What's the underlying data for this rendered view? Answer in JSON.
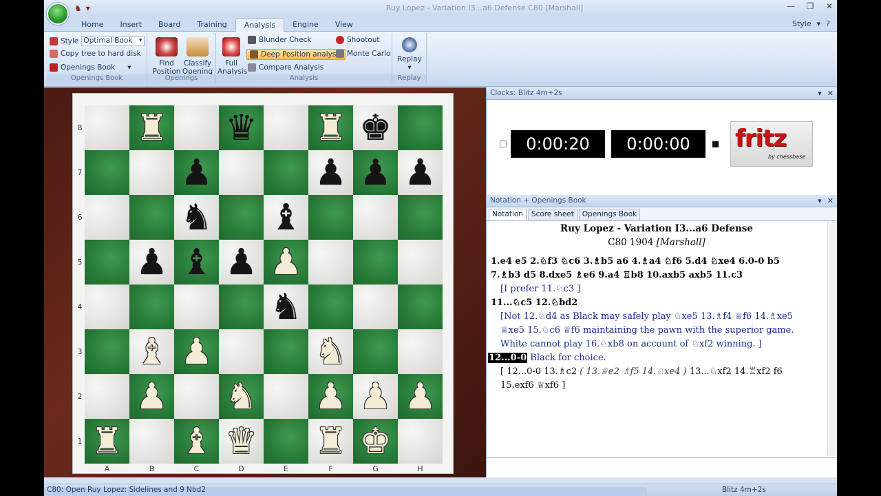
{
  "window": {
    "title": "Ruy Lopez - Variation I3...a6 Defense  C80  [Marshall]",
    "qat": [
      "♞",
      "▾"
    ],
    "controls": [
      "—",
      "❐",
      "✕"
    ]
  },
  "ribbon_tabs": [
    "Home",
    "Insert",
    "Board",
    "Training",
    "Analysis",
    "Engine",
    "View"
  ],
  "active_tab": "Analysis",
  "style_menu": {
    "label": "Style",
    "arrow": "▾",
    "help": "?"
  },
  "ribbon": {
    "openings_book": {
      "style_label": "Style",
      "style_value": "Optimal Book",
      "copy_tree": "Copy tree to hard disk",
      "openings_book": "Openings Book",
      "group_label": "Openings Book"
    },
    "openings": {
      "find_position": [
        "Find",
        "Position"
      ],
      "classify_opening": [
        "Classify",
        "Opening"
      ],
      "group_label": "Openings"
    },
    "analysis": {
      "full_analysis": [
        "Full",
        "Analysis"
      ],
      "blunder_check": "Blunder Check",
      "deep_position": "Deep Position analysis",
      "compare_analysis": "Compare Analysis",
      "shootout": "Shootout",
      "monte_carlo": "Monte Carlo",
      "group_label": "Analysis"
    },
    "replay": {
      "label": "Replay",
      "group_label": "Replay"
    }
  },
  "board": {
    "ranks": [
      "8",
      "7",
      "6",
      "5",
      "4",
      "3",
      "2",
      "1"
    ],
    "files": [
      "A",
      "B",
      "C",
      "D",
      "E",
      "F",
      "G",
      "H"
    ],
    "position": [
      [
        "",
        "wR",
        "",
        "bQ",
        "",
        "wR",
        "bK",
        ""
      ],
      [
        "",
        "",
        "bP",
        "",
        "",
        "bP",
        "bP",
        "bP"
      ],
      [
        "",
        "",
        "bN",
        "",
        "bB",
        "",
        "",
        ""
      ],
      [
        "",
        "bP",
        "bB",
        "bP",
        "wP",
        "",
        "",
        ""
      ],
      [
        "",
        "",
        "",
        "",
        "bN",
        "",
        "",
        ""
      ],
      [
        "",
        "wB",
        "wP",
        "",
        "",
        "wN",
        "",
        ""
      ],
      [
        "",
        "wP",
        "",
        "wN",
        "",
        "wP",
        "wP",
        "wP"
      ],
      [
        "wR",
        "",
        "wB",
        "wQ",
        "",
        "wR",
        "wK",
        ""
      ]
    ],
    "glyphs": {
      "K": "♚",
      "Q": "♛",
      "R": "♜",
      "B": "♝",
      "N": "♞",
      "P": "♟"
    }
  },
  "clock_panel": {
    "title": "Clocks: Blitz 4m+2s",
    "white_time": "0:00:20",
    "black_time": "0:00:00",
    "logo_text": "fritz",
    "logo_sub": "by chessbase"
  },
  "notation_panel": {
    "title": "Notation + Openings Book",
    "tabs": [
      "Notation",
      "Score sheet",
      "Openings Book"
    ],
    "game_title": "Ruy Lopez - Variation I3...a6 Defense",
    "game_eco": "C80",
    "game_year": "1904",
    "game_annotator": "[Marshall]",
    "lines": {
      "l1": "1.e4  e5  2.♘f3  ♘c6  3.♗b5  a6  4.♗a4  ♘f6  5.d4  ♘xe4  6.0-0  b5",
      "l2": "7.♗b3  d5  8.dxe5  ♗e6  9.a4  ♖b8  10.axb5  axb5  11.c3",
      "l3": "[I prefer  11.♘c3 ]",
      "l4": "11...♘c5  12.♘bd2",
      "l5": "[Not  12.♘d4 as Black may safely play  ♘xe5  13.♗f4  ♕f6  14.♗xe5",
      "l6": "♕xe5  15.♘c6  ♕f6 maintaining the pawn with the superior game.",
      "l7": "White cannot play  16.♘xb8 on account of  ♘xf2 winning. ]",
      "current_move": "12...0-0",
      "l8_rest": "Black for choice.",
      "l9a": "[ 12...0-0  13.♗c2",
      "l9b": "( 13.♕e2  ♗f5  14.♘xe4 )",
      "l9c": " 13...♘xf2  14.♖xf2  f6",
      "l10": "15.exf6  ♕xf6 ]"
    }
  },
  "statusbar": {
    "left": "C80: Open Ruy Lopez: Sidelines and 9 Nbd2",
    "right": "Blitz 4m+2s"
  },
  "colors": {
    "accent": "#d7e3f2",
    "board_dark": "#277a38",
    "board_light": "#e3e3e0",
    "highlight": "#ffb94d",
    "logo_red": "#c81414"
  }
}
